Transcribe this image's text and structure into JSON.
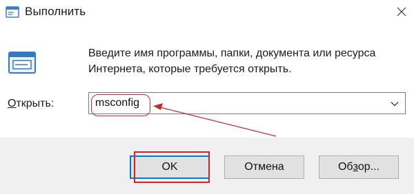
{
  "window": {
    "title": "Выполнить",
    "icon": "run-dialog-icon",
    "close_icon": "close-icon"
  },
  "body": {
    "icon": "run-program-icon",
    "description_line1": "Введите имя программы, папки, документа или ресурса",
    "description_line2": "Интернета, которые требуется открыть."
  },
  "open": {
    "label_prefix": "",
    "label_accel": "О",
    "label_rest": "ткрыть:",
    "value": "msconfig"
  },
  "buttons": {
    "ok": "OK",
    "cancel": "Отмена",
    "browse_prefix": "Об",
    "browse_accel": "з",
    "browse_rest": "ор..."
  },
  "annotations": {
    "highlight_color": "#d61f1f"
  }
}
